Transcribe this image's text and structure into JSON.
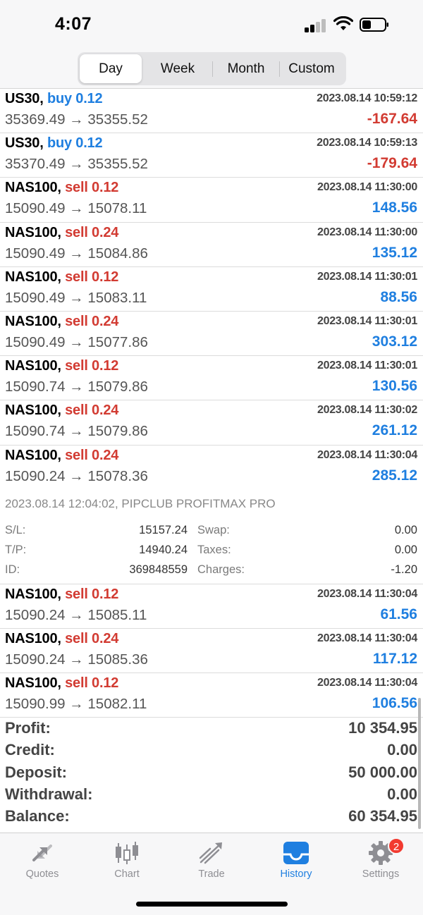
{
  "status": {
    "time": "4:07"
  },
  "periods": [
    {
      "label": "Day",
      "active": true
    },
    {
      "label": "Week",
      "active": false
    },
    {
      "label": "Month",
      "active": false
    },
    {
      "label": "Custom",
      "active": false
    }
  ],
  "trades": [
    {
      "symbol": "US30,",
      "side": "buy",
      "volume": "0.12",
      "prices": "35369.49 → 35355.52",
      "time": "2023.08.14 10:59:12",
      "profit": "-167.64"
    },
    {
      "symbol": "US30,",
      "side": "buy",
      "volume": "0.12",
      "prices": "35370.49 → 35355.52",
      "time": "2023.08.14 10:59:13",
      "profit": "-179.64"
    },
    {
      "symbol": "NAS100,",
      "side": "sell",
      "volume": "0.12",
      "prices": "15090.49 → 15078.11",
      "time": "2023.08.14 11:30:00",
      "profit": "148.56"
    },
    {
      "symbol": "NAS100,",
      "side": "sell",
      "volume": "0.24",
      "prices": "15090.49 → 15084.86",
      "time": "2023.08.14 11:30:00",
      "profit": "135.12"
    },
    {
      "symbol": "NAS100,",
      "side": "sell",
      "volume": "0.12",
      "prices": "15090.49 → 15083.11",
      "time": "2023.08.14 11:30:01",
      "profit": "88.56"
    },
    {
      "symbol": "NAS100,",
      "side": "sell",
      "volume": "0.24",
      "prices": "15090.49 → 15077.86",
      "time": "2023.08.14 11:30:01",
      "profit": "303.12"
    },
    {
      "symbol": "NAS100,",
      "side": "sell",
      "volume": "0.12",
      "prices": "15090.74 → 15079.86",
      "time": "2023.08.14 11:30:01",
      "profit": "130.56"
    },
    {
      "symbol": "NAS100,",
      "side": "sell",
      "volume": "0.24",
      "prices": "15090.74 → 15079.86",
      "time": "2023.08.14 11:30:02",
      "profit": "261.12"
    },
    {
      "symbol": "NAS100,",
      "side": "sell",
      "volume": "0.24",
      "prices": "15090.24 → 15078.36",
      "time": "2023.08.14 11:30:04",
      "profit": "285.12"
    }
  ],
  "details": {
    "header": "2023.08.14 12:04:02, PIPCLUB PROFITMAX PRO",
    "sl_label": "S/L:",
    "sl": "15157.24",
    "tp_label": "T/P:",
    "tp": "14940.24",
    "id_label": "ID:",
    "id": "369848559",
    "swap_label": "Swap:",
    "swap": "0.00",
    "taxes_label": "Taxes:",
    "taxes": "0.00",
    "charges_label": "Charges:",
    "charges": "-1.20"
  },
  "trades_after": [
    {
      "symbol": "NAS100,",
      "side": "sell",
      "volume": "0.12",
      "prices": "15090.24 → 15085.11",
      "time": "2023.08.14 11:30:04",
      "profit": "61.56"
    },
    {
      "symbol": "NAS100,",
      "side": "sell",
      "volume": "0.24",
      "prices": "15090.24 → 15085.36",
      "time": "2023.08.14 11:30:04",
      "profit": "117.12"
    },
    {
      "symbol": "NAS100,",
      "side": "sell",
      "volume": "0.12",
      "prices": "15090.99 → 15082.11",
      "time": "2023.08.14 11:30:04",
      "profit": "106.56"
    }
  ],
  "summary": [
    {
      "label": "Profit:",
      "value": "10 354.95"
    },
    {
      "label": "Credit:",
      "value": "0.00"
    },
    {
      "label": "Deposit:",
      "value": "50 000.00"
    },
    {
      "label": "Withdrawal:",
      "value": "0.00"
    },
    {
      "label": "Balance:",
      "value": "60 354.95"
    }
  ],
  "tabs": [
    {
      "label": "Quotes",
      "icon": "quotes-icon"
    },
    {
      "label": "Chart",
      "icon": "chart-icon"
    },
    {
      "label": "Trade",
      "icon": "trade-icon"
    },
    {
      "label": "History",
      "icon": "history-icon",
      "active": true
    },
    {
      "label": "Settings",
      "icon": "settings-icon",
      "badge": "2"
    }
  ],
  "colors": {
    "buy": "#1f7fe0",
    "sell": "#d23b32",
    "accent": "#1f7fe0",
    "badge": "#f23a30"
  }
}
